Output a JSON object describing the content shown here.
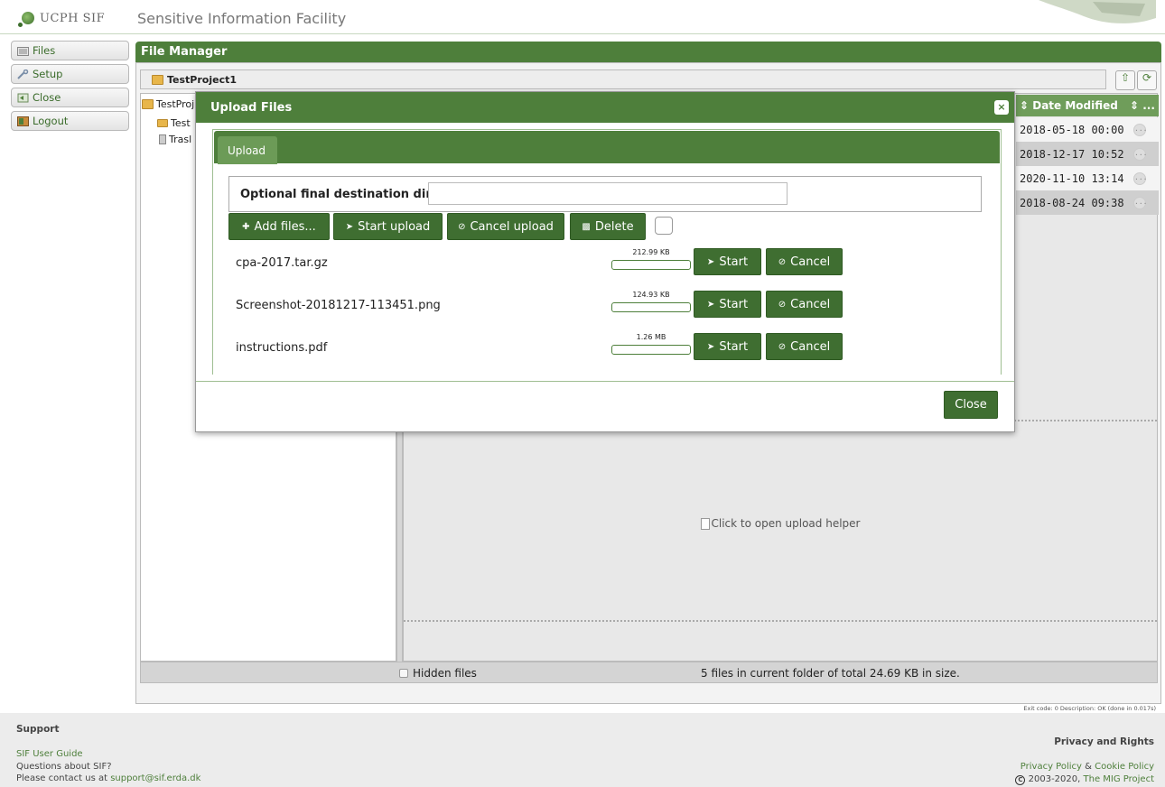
{
  "header": {
    "logo_text": "UCPH SIF",
    "site_title": "Sensitive Information Facility"
  },
  "menu": {
    "items": [
      "Files",
      "Setup",
      "Close",
      "Logout"
    ]
  },
  "file_manager": {
    "title": "File Manager",
    "path": "TestProject1",
    "tree": [
      "TestProj",
      "Test",
      "Trasl"
    ],
    "columns": {
      "date_modified": "Date Modified",
      "more": "..."
    },
    "date_rows": [
      "2018-05-18 00:00",
      "2018-12-17 10:52",
      "2020-11-10 13:14",
      "2018-08-24 09:38"
    ],
    "drop_zone_text": "Click to open upload helper",
    "hidden_files_label": "Hidden files",
    "summary": "5 files in current folder of total 24.69 KB in size.",
    "exit_code": "Exit code: 0 Description: OK (done in 0.017s)"
  },
  "modal": {
    "title": "Upload Files",
    "close_x": "×",
    "tab": "Upload",
    "dest_label": "Optional final destination dir:",
    "dest_value": "",
    "buttons": {
      "add": "Add files...",
      "start_upload": "Start upload",
      "cancel_upload": "Cancel upload",
      "delete": "Delete"
    },
    "files": [
      {
        "name": "cpa-2017.tar.gz",
        "size": "212.99 KB",
        "progress": 0
      },
      {
        "name": "Screenshot-20181217-113451.png",
        "size": "124.93 KB",
        "progress": 0
      },
      {
        "name": "instructions.pdf",
        "size": "1.26 MB",
        "progress": 0
      }
    ],
    "row_start": "Start",
    "row_cancel": "Cancel",
    "close_label": "Close"
  },
  "footer": {
    "support_heading": "Support",
    "user_guide": "SIF User Guide",
    "questions": "Questions about SIF?",
    "contact_prefix": "Please contact us at ",
    "contact_email": "support@sif.erda.dk",
    "privacy_heading": "Privacy and Rights",
    "privacy_policy": "Privacy Policy",
    "amp": " & ",
    "cookie_policy": "Cookie Policy",
    "copyright": "2003-2020, ",
    "mig_project": "The MIG Project"
  }
}
